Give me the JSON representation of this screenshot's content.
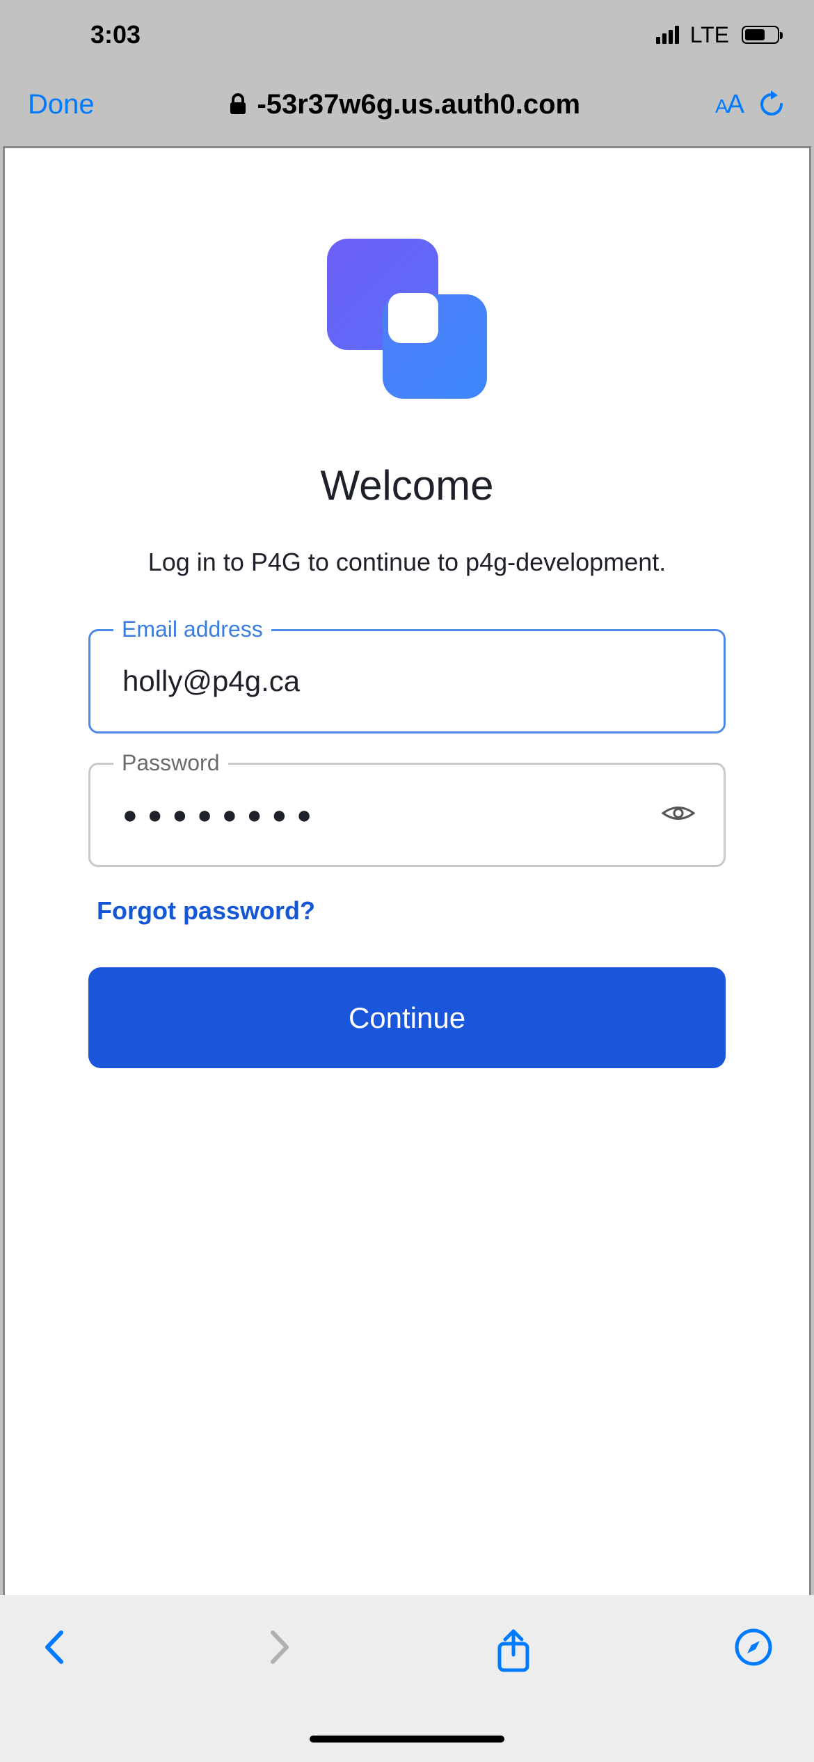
{
  "status": {
    "time": "3:03",
    "network": "LTE"
  },
  "browser": {
    "done": "Done",
    "url": "-53r37w6g.us.auth0.com",
    "textsize": "AA"
  },
  "login": {
    "title": "Welcome",
    "subtitle": "Log in to P4G to continue to p4g-development.",
    "email_label": "Email address",
    "email_value": "holly@p4g.ca",
    "password_label": "Password",
    "password_dots": "●●●●●●●●",
    "forgot": "Forgot password?",
    "continue": "Continue"
  },
  "colors": {
    "accent_blue": "#007aff",
    "primary_button": "#1a56db",
    "link_blue": "#1356d6",
    "logo_start": "#6d5ef7",
    "logo_end": "#3d88fb"
  }
}
